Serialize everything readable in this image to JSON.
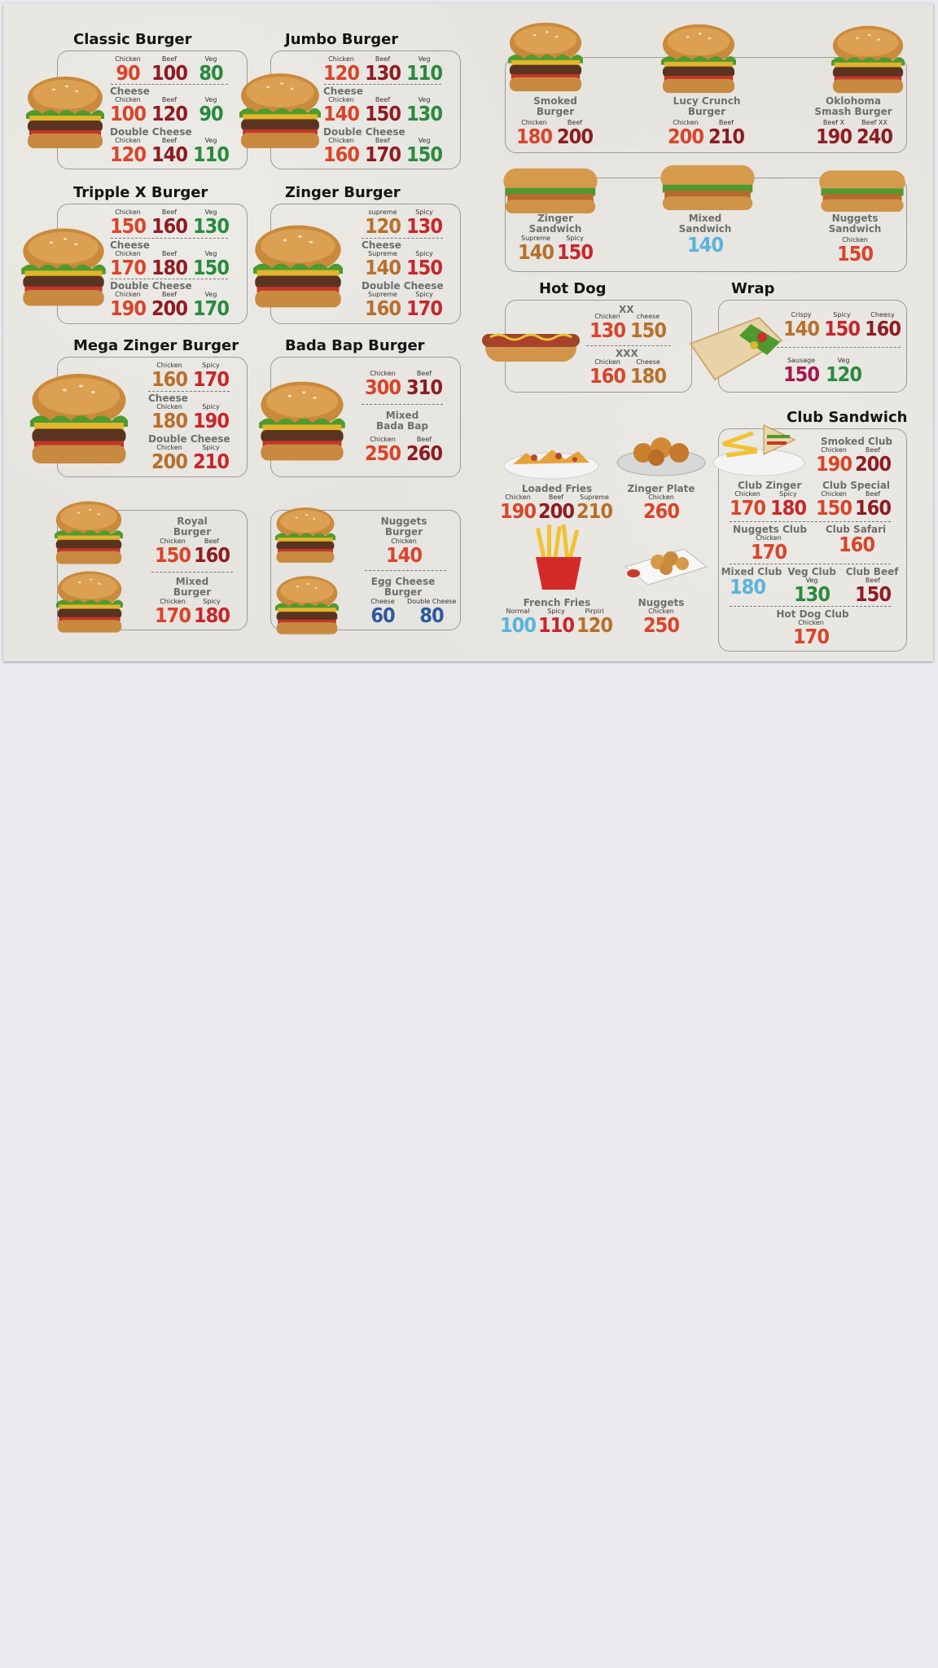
{
  "sections": {
    "classic": {
      "title": "Classic Burger",
      "rows": [
        {
          "name": "",
          "items": [
            {
              "label": "Chicken",
              "price": "90"
            },
            {
              "label": "Beef",
              "price": "100"
            },
            {
              "label": "Veg",
              "price": "80"
            }
          ]
        },
        {
          "name": "Cheese",
          "items": [
            {
              "label": "Chicken",
              "price": "100"
            },
            {
              "label": "Beef",
              "price": "120"
            },
            {
              "label": "Veg",
              "price": "90"
            }
          ]
        },
        {
          "name": "Double Cheese",
          "items": [
            {
              "label": "Chicken",
              "price": "120"
            },
            {
              "label": "Beef",
              "price": "140"
            },
            {
              "label": "Veg",
              "price": "110"
            }
          ]
        }
      ]
    },
    "jumbo": {
      "title": "Jumbo Burger",
      "rows": [
        {
          "name": "",
          "items": [
            {
              "label": "Chicken",
              "price": "120"
            },
            {
              "label": "Beef",
              "price": "130"
            },
            {
              "label": "Veg",
              "price": "110"
            }
          ]
        },
        {
          "name": "Cheese",
          "items": [
            {
              "label": "Chicken",
              "price": "140"
            },
            {
              "label": "Beef",
              "price": "150"
            },
            {
              "label": "Veg",
              "price": "130"
            }
          ]
        },
        {
          "name": "Double Cheese",
          "items": [
            {
              "label": "Chicken",
              "price": "160"
            },
            {
              "label": "Beef",
              "price": "170"
            },
            {
              "label": "Veg",
              "price": "150"
            }
          ]
        }
      ]
    },
    "tripple": {
      "title": "Tripple X Burger",
      "rows": [
        {
          "name": "",
          "items": [
            {
              "label": "Chicken",
              "price": "150"
            },
            {
              "label": "Beef",
              "price": "160"
            },
            {
              "label": "Veg",
              "price": "130"
            }
          ]
        },
        {
          "name": "Cheese",
          "items": [
            {
              "label": "Chicken",
              "price": "170"
            },
            {
              "label": "Beef",
              "price": "180"
            },
            {
              "label": "Veg",
              "price": "150"
            }
          ]
        },
        {
          "name": "Double Cheese",
          "items": [
            {
              "label": "Chicken",
              "price": "190"
            },
            {
              "label": "Beef",
              "price": "200"
            },
            {
              "label": "Veg",
              "price": "170"
            }
          ]
        }
      ]
    },
    "zinger": {
      "title": "Zinger Burger",
      "rows": [
        {
          "name": "",
          "items": [
            {
              "label": "supreme",
              "price": "120"
            },
            {
              "label": "Spicy",
              "price": "130"
            }
          ]
        },
        {
          "name": "Cheese",
          "items": [
            {
              "label": "Supreme",
              "price": "140"
            },
            {
              "label": "Spicy",
              "price": "150"
            }
          ]
        },
        {
          "name": "Double Cheese",
          "items": [
            {
              "label": "Supreme",
              "price": "160"
            },
            {
              "label": "Spicy",
              "price": "170"
            }
          ]
        }
      ]
    },
    "mega": {
      "title": "Mega Zinger Burger",
      "rows": [
        {
          "name": "",
          "items": [
            {
              "label": "Chicken",
              "price": "160"
            },
            {
              "label": "Spicy",
              "price": "170"
            }
          ]
        },
        {
          "name": "Cheese",
          "items": [
            {
              "label": "Chicken",
              "price": "180"
            },
            {
              "label": "Spicy",
              "price": "190"
            }
          ]
        },
        {
          "name": "Double Cheese",
          "items": [
            {
              "label": "Chicken",
              "price": "200"
            },
            {
              "label": "Spicy",
              "price": "210"
            }
          ]
        }
      ]
    },
    "badabap": {
      "title": "Bada Bap Burger",
      "rows": [
        {
          "name": "",
          "items": [
            {
              "label": "Chicken",
              "price": "300"
            },
            {
              "label": "Beef",
              "price": "310"
            }
          ]
        },
        {
          "name": "Mixed Bada Bap",
          "items": [
            {
              "label": "Chicken",
              "price": "250"
            },
            {
              "label": "Beef",
              "price": "260"
            }
          ]
        }
      ]
    },
    "royal": {
      "name": "Royal Burger",
      "items": [
        {
          "label": "Chicken",
          "price": "150"
        },
        {
          "label": "Beef",
          "price": "160"
        }
      ]
    },
    "mixedburger": {
      "name": "Mixed Burger",
      "items": [
        {
          "label": "Chicken",
          "price": "170"
        },
        {
          "label": "Spicy",
          "price": "180"
        }
      ]
    },
    "nuggetsburger": {
      "name": "Nuggets Burger",
      "items": [
        {
          "label": "Chicken",
          "price": "140"
        }
      ]
    },
    "eggcheese": {
      "name": "Egg Cheese Burger",
      "items": [
        {
          "label": "Cheese",
          "price": "60"
        },
        {
          "label": "Double Cheese",
          "price": "80"
        }
      ]
    },
    "smoked": {
      "name": "Smoked Burger",
      "items": [
        {
          "label": "Chicken",
          "price": "180"
        },
        {
          "label": "Beef",
          "price": "200"
        }
      ]
    },
    "lucy": {
      "name": "Lucy Crunch Burger",
      "items": [
        {
          "label": "Chicken",
          "price": "200"
        },
        {
          "label": "Beef",
          "price": "210"
        }
      ]
    },
    "oklahoma": {
      "name": "Oklohoma Smash Burger",
      "items": [
        {
          "label": "Beef X",
          "price": "190"
        },
        {
          "label": "Beef XX",
          "price": "240"
        }
      ]
    },
    "zingersandwich": {
      "name": "Zinger Sandwich",
      "items": [
        {
          "label": "Supreme",
          "price": "140"
        },
        {
          "label": "Spicy",
          "price": "150"
        }
      ]
    },
    "mixedsandwich": {
      "name": "Mixed Sandwich",
      "items": [
        {
          "label": "",
          "price": "140"
        }
      ]
    },
    "nuggetssandwich": {
      "name": "Nuggets Sandwich",
      "items": [
        {
          "label": "Chicken",
          "price": "150"
        }
      ]
    },
    "hotdog": {
      "title": "Hot Dog",
      "rows": [
        {
          "name": "XX",
          "items": [
            {
              "label": "Chicken",
              "price": "130"
            },
            {
              "label": "cheese",
              "price": "150"
            }
          ]
        },
        {
          "name": "XXX",
          "items": [
            {
              "label": "Chicken",
              "price": "160"
            },
            {
              "label": "Cheese",
              "price": "180"
            }
          ]
        }
      ]
    },
    "wrap": {
      "title": "Wrap",
      "items": [
        {
          "label": "Crispy",
          "price": "140"
        },
        {
          "label": "Spicy",
          "price": "150"
        },
        {
          "label": "Cheesy",
          "price": "160"
        },
        {
          "label": "Sausage",
          "price": "150"
        },
        {
          "label": "Veg",
          "price": "120"
        }
      ]
    },
    "loadedfries": {
      "name": "Loaded Fries",
      "items": [
        {
          "label": "Chicken",
          "price": "190"
        },
        {
          "label": "Beef",
          "price": "200"
        },
        {
          "label": "Supreme",
          "price": "210"
        }
      ]
    },
    "zingerplate": {
      "name": "Zinger Plate",
      "items": [
        {
          "label": "Chicken",
          "price": "260"
        }
      ]
    },
    "frenchfries": {
      "name": "French Fries",
      "items": [
        {
          "label": "Normal",
          "price": "100"
        },
        {
          "label": "Spicy",
          "price": "110"
        },
        {
          "label": "Pirpiri",
          "price": "120"
        }
      ]
    },
    "nuggets": {
      "name": "Nuggets",
      "items": [
        {
          "label": "Chicken",
          "price": "250"
        }
      ]
    },
    "club": {
      "title": "Club Sandwich",
      "smoked": {
        "name": "Smoked Club",
        "items": [
          {
            "label": "Chicken",
            "price": "190"
          },
          {
            "label": "Beef",
            "price": "200"
          }
        ]
      },
      "zinger": {
        "name": "Club Zinger",
        "items": [
          {
            "label": "Chicken",
            "price": "170"
          },
          {
            "label": "Spicy",
            "price": "180"
          }
        ]
      },
      "special": {
        "name": "Club Special",
        "items": [
          {
            "label": "Chicken",
            "price": "150"
          },
          {
            "label": "Beef",
            "price": "160"
          }
        ]
      },
      "nuggets": {
        "name": "Nuggets Club",
        "items": [
          {
            "label": "Chicken",
            "price": "170"
          }
        ]
      },
      "safari": {
        "name": "Club Safari",
        "items": [
          {
            "label": "",
            "price": "160"
          }
        ]
      },
      "mixed": {
        "name": "Mixed Club",
        "items": [
          {
            "label": "",
            "price": "180"
          }
        ]
      },
      "veg": {
        "name": "Veg Club",
        "items": [
          {
            "label": "Veg",
            "price": "130"
          }
        ]
      },
      "beef": {
        "name": "Club Beef",
        "items": [
          {
            "label": "Beef",
            "price": "150"
          }
        ]
      },
      "hotdog": {
        "name": "Hot Dog Club",
        "items": [
          {
            "label": "Chicken",
            "price": "170"
          }
        ]
      }
    }
  },
  "colors": {
    "orange": "#d8452b",
    "maroon": "#8e1c22",
    "green": "#2a8a3f",
    "tan": "#b8702c",
    "red": "#c8262b",
    "skyblue": "#5bb3dc",
    "navy": "#2e5aa0",
    "magenta": "#a3174f",
    "box_border": "#9a9a9a",
    "background": "#e6e4df"
  }
}
